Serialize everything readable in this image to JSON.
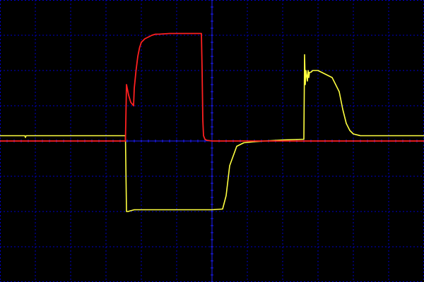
{
  "chart_data": {
    "type": "line",
    "title": "",
    "xlabel": "",
    "ylabel": "",
    "xlim": [
      -6,
      6
    ],
    "ylim": [
      -4,
      4
    ],
    "grid": true,
    "legend": "none",
    "colors": {
      "background": "#000000",
      "grid": "#0000c8",
      "axis": "#1e1eff"
    },
    "series": [
      {
        "color": "#ffff40",
        "x": [
          -6.0,
          -5.3,
          -5.28,
          -5.26,
          -4.5,
          -2.45,
          -2.42,
          -2.38,
          -2.2,
          -1.0,
          0.0,
          0.3,
          0.4,
          0.5,
          0.7,
          0.9,
          1.2,
          1.5,
          2.0,
          2.6,
          2.62,
          2.64,
          2.66,
          2.7,
          2.72,
          2.74,
          2.76,
          2.8,
          2.85,
          3.0,
          3.4,
          3.6,
          3.7,
          3.8,
          3.9,
          4.0,
          4.2,
          4.5,
          5.0,
          6.0
        ],
        "y": [
          0.15,
          0.15,
          0.1,
          0.15,
          0.15,
          0.15,
          -2.0,
          -2.0,
          -1.95,
          -1.95,
          -1.95,
          -1.93,
          -1.55,
          -0.7,
          -0.15,
          -0.05,
          -0.02,
          0.0,
          0.03,
          0.05,
          2.45,
          1.6,
          2.0,
          1.7,
          2.0,
          1.8,
          1.95,
          1.95,
          2.0,
          2.0,
          1.8,
          1.4,
          0.9,
          0.5,
          0.3,
          0.2,
          0.15,
          0.15,
          0.15,
          0.15
        ]
      },
      {
        "color": "#ff2020",
        "x": [
          -6.0,
          -2.45,
          -2.42,
          -2.36,
          -2.3,
          -2.22,
          -2.2,
          -2.15,
          -2.1,
          -2.05,
          -2.0,
          -1.9,
          -1.8,
          -1.7,
          -1.6,
          -1.5,
          -1.2,
          -0.8,
          -0.3,
          -0.28,
          -0.26,
          -0.24,
          -0.2,
          -0.15,
          0.0,
          6.0
        ],
        "y": [
          0.0,
          0.0,
          1.6,
          1.3,
          1.1,
          1.0,
          1.5,
          2.0,
          2.4,
          2.65,
          2.8,
          2.9,
          2.95,
          3.0,
          3.03,
          3.03,
          3.05,
          3.05,
          3.05,
          2.0,
          0.6,
          0.15,
          0.05,
          0.02,
          0.0,
          0.0
        ]
      }
    ]
  }
}
